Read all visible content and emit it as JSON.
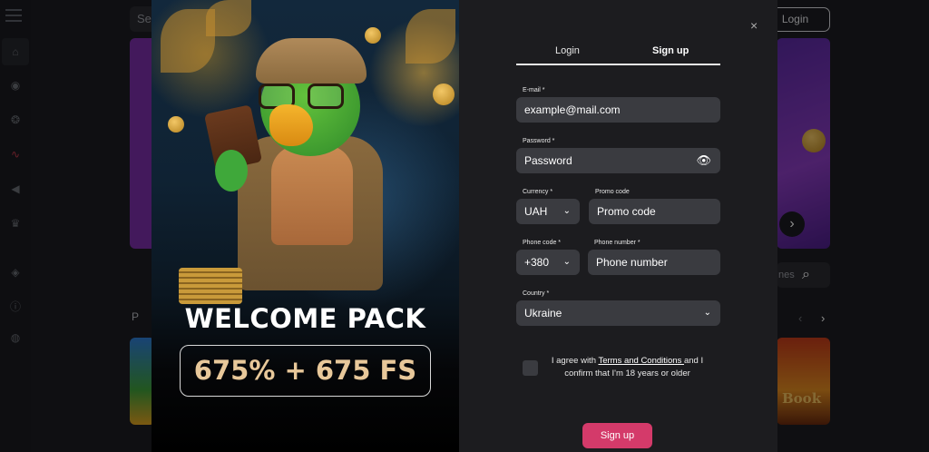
{
  "background": {
    "search_placeholder": "Sea",
    "login_button": "Login",
    "search_games_fragment": "nes",
    "section_label_fragment": "P",
    "game_tile_text": "Book"
  },
  "promo": {
    "headline": "WELCOME PACK",
    "offer": "675% + 675 FS"
  },
  "tabs": [
    {
      "label": "Login"
    },
    {
      "label": "Sign up",
      "active": true
    }
  ],
  "form": {
    "email": {
      "label": "E-mail *",
      "placeholder": "example@mail.com"
    },
    "password": {
      "label": "Password *",
      "placeholder": "Password"
    },
    "currency": {
      "label": "Currency *",
      "value": "UAH"
    },
    "promo_code": {
      "label": "Promo code",
      "placeholder": "Promo code"
    },
    "phone_code": {
      "label": "Phone code *",
      "value": "+380"
    },
    "phone_number": {
      "label": "Phone number *",
      "placeholder": "Phone number"
    },
    "country": {
      "label": "Country *",
      "value": "Ukraine"
    },
    "agree": {
      "prefix": "I agree with ",
      "link": "Terms and Conditions ",
      "suffix": "and I confirm that I'm 18 years or older"
    },
    "submit": "Sign up"
  },
  "icons": {
    "close": "×",
    "eye": "👁",
    "chevron_down": "⌄"
  },
  "colors": {
    "accent": "#d43a6a",
    "modal_bg": "#1c1c1f",
    "field_bg": "#3a3b40"
  }
}
